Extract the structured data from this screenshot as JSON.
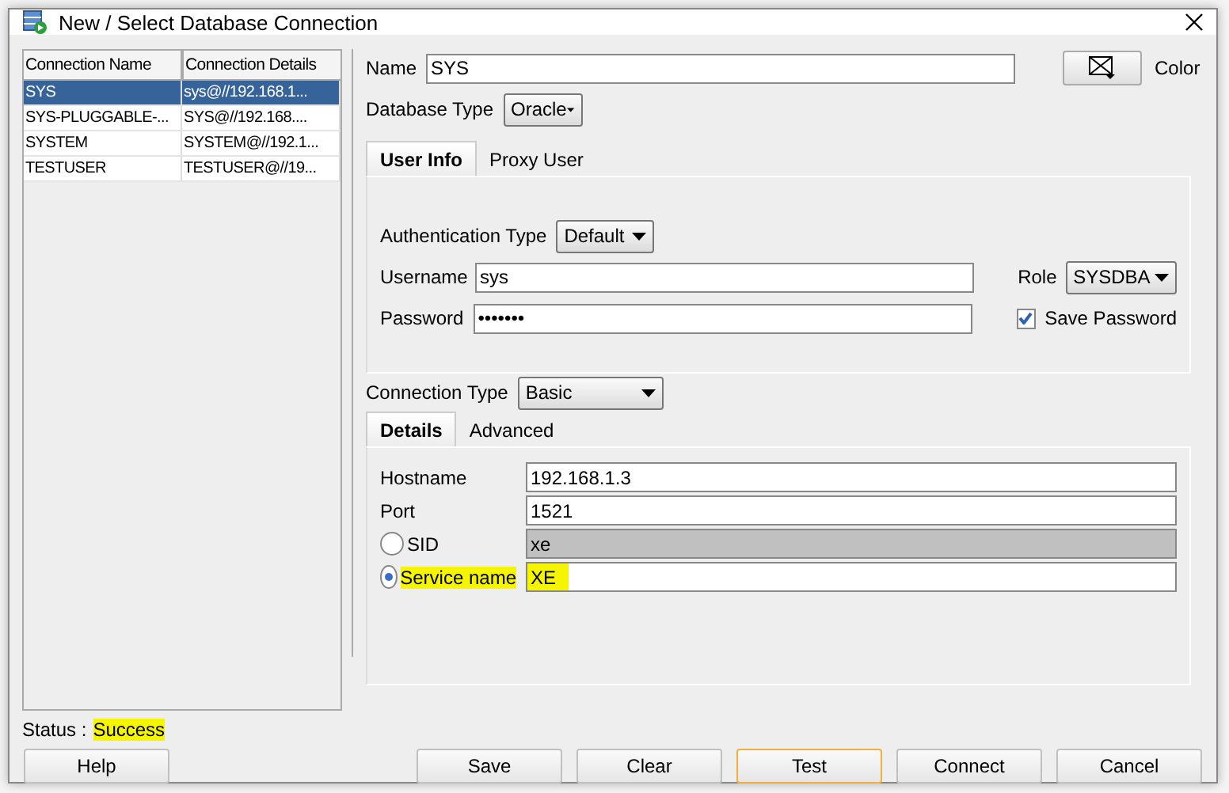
{
  "window": {
    "title": "New / Select Database Connection"
  },
  "connections": {
    "columns": [
      "Connection Name",
      "Connection Details"
    ],
    "rows": [
      {
        "cells": [
          "SYS",
          "sys@//192.168.1..."
        ],
        "selected": true
      },
      {
        "cells": [
          "SYS-PLUGGABLE-...",
          "SYS@//192.168...."
        ],
        "selected": false
      },
      {
        "cells": [
          "SYSTEM",
          "SYSTEM@//192.1..."
        ],
        "selected": false
      },
      {
        "cells": [
          "TESTUSER",
          "TESTUSER@//19..."
        ],
        "selected": false
      }
    ]
  },
  "name_field": {
    "label": "Name",
    "value": "SYS"
  },
  "color_button": {
    "label": "Color"
  },
  "database_type": {
    "label": "Database Type",
    "value": "Oracle"
  },
  "user_tabs": [
    {
      "label": "User Info",
      "selected": true
    },
    {
      "label": "Proxy User",
      "selected": false
    }
  ],
  "user_info": {
    "auth_type": {
      "label": "Authentication Type",
      "value": "Default"
    },
    "username": {
      "label": "Username",
      "value": "sys"
    },
    "password": {
      "label": "Password",
      "value": "•••••••"
    },
    "role": {
      "label": "Role",
      "value": "SYSDBA"
    },
    "save_password": {
      "label": "Save Password",
      "checked": true
    }
  },
  "connection_type": {
    "label": "Connection Type",
    "value": "Basic"
  },
  "detail_tabs": [
    {
      "label": "Details",
      "selected": true
    },
    {
      "label": "Advanced",
      "selected": false
    }
  ],
  "details": [
    {
      "kind": "text",
      "label": "Hostname",
      "value": "192.168.1.3"
    },
    {
      "kind": "text",
      "label": "Port",
      "value": "1521"
    },
    {
      "kind": "radio",
      "label": "SID",
      "value": "xe",
      "selected": false,
      "highlighted": false
    },
    {
      "kind": "radio",
      "label": "Service name",
      "value": "XE",
      "selected": true,
      "highlighted": true
    }
  ],
  "status": {
    "label": "Status :",
    "value": "Success",
    "highlighted": true
  },
  "buttons": [
    {
      "label": "Help",
      "focused": false
    },
    {
      "label": "Save",
      "focused": false
    },
    {
      "label": "Clear",
      "focused": false
    },
    {
      "label": "Test",
      "focused": true
    },
    {
      "label": "Connect",
      "focused": false
    },
    {
      "label": "Cancel",
      "focused": false
    }
  ]
}
